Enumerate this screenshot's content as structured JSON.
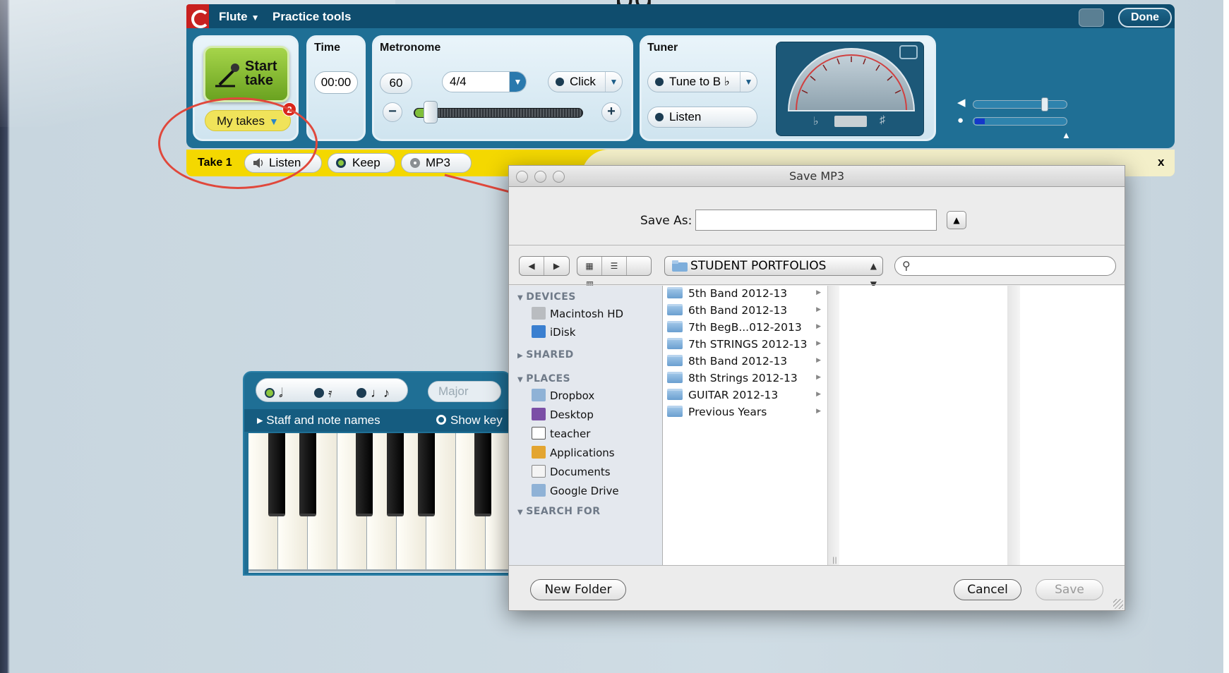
{
  "page": {
    "title_fragment": "pg"
  },
  "appbar": {
    "instrument_label": "Flute",
    "practice_tools_label": "Practice tools",
    "done_label": "Done"
  },
  "recording": {
    "start_label_line1": "Start",
    "start_label_line2": "take",
    "my_takes_label": "My takes",
    "takes_badge": "2"
  },
  "time": {
    "label": "Time",
    "value": "00:00"
  },
  "metronome": {
    "label": "Metronome",
    "tempo": "60",
    "meter": "4/4",
    "sound": "Click",
    "minus": "−",
    "plus": "+"
  },
  "tuner": {
    "label": "Tuner",
    "tune_to": "Tune to B ♭",
    "listen_label": "Listen",
    "flat_symbol": "♭",
    "sharp_symbol": "♯"
  },
  "take_bar": {
    "take_label": "Take 1",
    "listen_label": "Listen",
    "keep_label": "Keep",
    "mp3_label": "MP3",
    "close_label": "x"
  },
  "keyboard": {
    "scale_label": "Major",
    "staff_label": "Staff and note names",
    "show_keys_label": "Show key"
  },
  "dialog": {
    "title": "Save MP3",
    "save_as_label": "Save As:",
    "save_as_value": "",
    "location": "STUDENT PORTFOLIOS",
    "search_placeholder": "",
    "sidebar": {
      "devices_header": "DEVICES",
      "devices": [
        "Macintosh HD",
        "iDisk"
      ],
      "shared_header": "SHARED",
      "places_header": "PLACES",
      "places": [
        "Dropbox",
        "Desktop",
        "teacher",
        "Applications",
        "Documents",
        "Google Drive"
      ],
      "search_header": "SEARCH FOR"
    },
    "folders": [
      "5th Band 2012-13",
      "6th Band 2012-13",
      "7th BegB...012-2013",
      "7th STRINGS 2012-13",
      "8th Band 2012-13",
      "8th Strings 2012-13",
      "GUITAR 2012-13",
      "Previous Years"
    ],
    "new_folder_label": "New Folder",
    "cancel_label": "Cancel",
    "save_label": "Save"
  },
  "colors": {
    "app_blue": "#1f6f95",
    "take_bar_yellow": "#f4d800",
    "start_green": "#8cc63f",
    "callout_red": "#e0483c"
  }
}
